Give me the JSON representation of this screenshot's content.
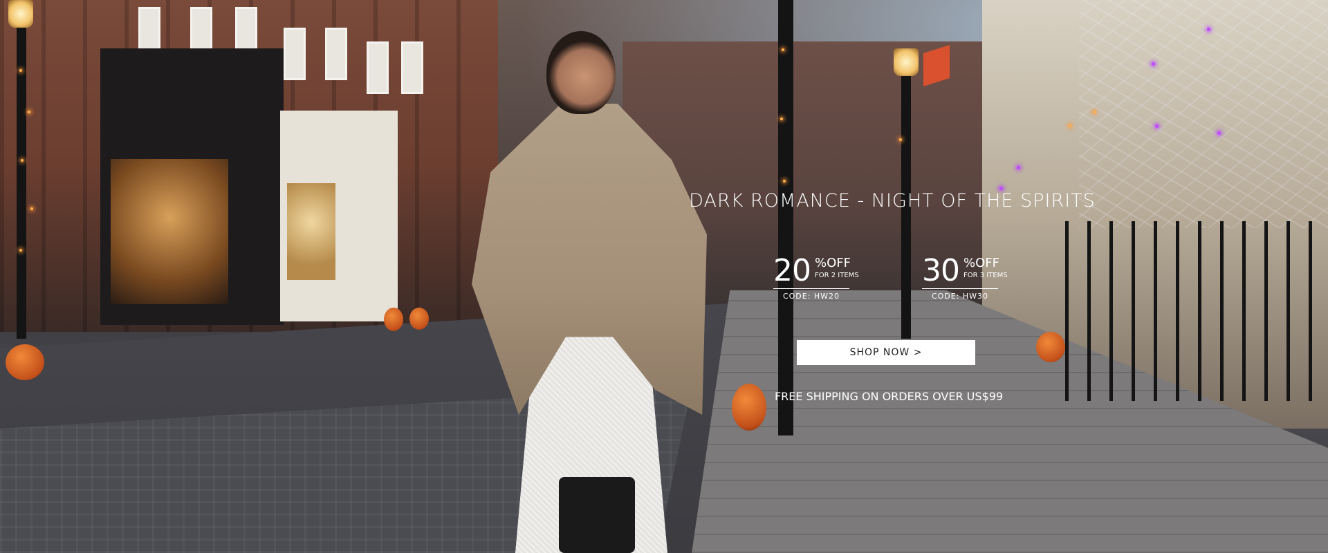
{
  "banner": {
    "title": "DARK ROMANCE - NIGHT OF THE SPIRITS",
    "offers": [
      {
        "percent": "20",
        "off_label": "%OFF",
        "condition": "FOR 2 ITEMS",
        "code": "CODE: HW20"
      },
      {
        "percent": "30",
        "off_label": "%OFF",
        "condition": "FOR 3 ITEMS",
        "code": "CODE: HW30"
      }
    ],
    "cta_label": "SHOP NOW >",
    "shipping_note": "FREE SHIPPING ON ORDERS OVER US$99"
  },
  "colors": {
    "text": "#ffffff",
    "button_bg": "#ffffff",
    "button_text": "#222222"
  }
}
